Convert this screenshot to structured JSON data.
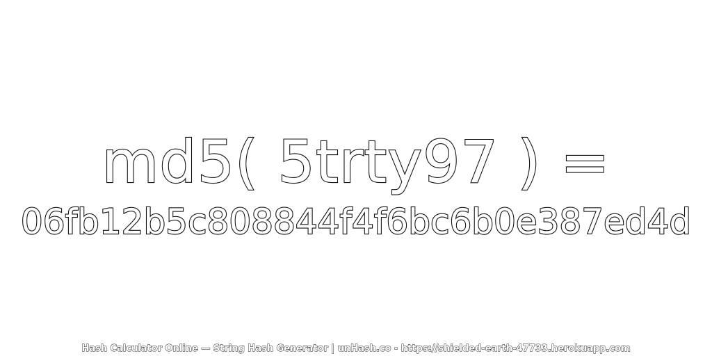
{
  "expression": "md5( 5trty97 ) =",
  "hash": "06fb12b5c808844f4f6bc6b0e387ed4d",
  "footer": "Hash Calculator Online — String Hash Generator | unHash.co - https://shielded-earth-47733.herokuapp.com",
  "colors": {
    "background": "#ffffff",
    "outline": "#111111",
    "fill": "#ffffff"
  }
}
